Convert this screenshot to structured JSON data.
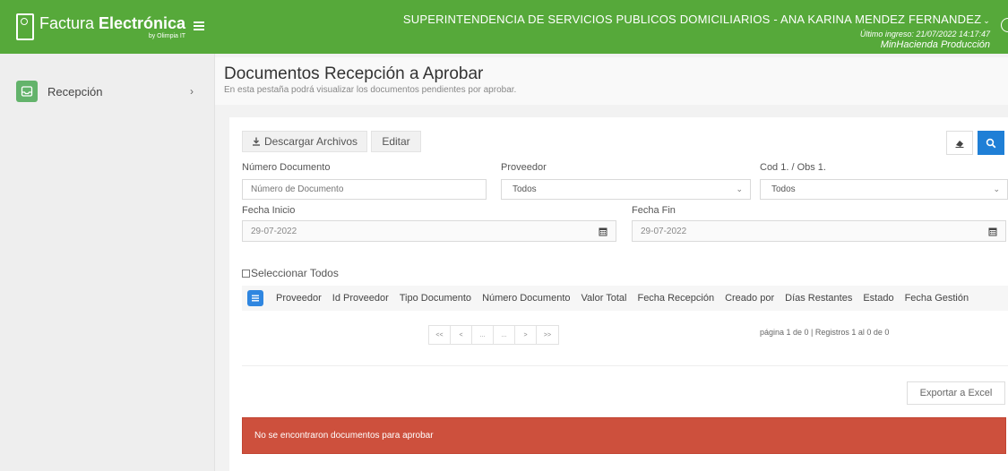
{
  "brand": {
    "name_light": "Factura ",
    "name_bold": "Electrónica",
    "by": "by Olimpia IT"
  },
  "user": {
    "name": "SUPERINTENDENCIA DE SERVICIOS PUBLICOS DOMICILIARIOS - ANA KARINA MENDEZ FERNANDEZ",
    "last_login": "Último ingreso: 21/07/2022 14:17:47",
    "environment": "MinHacienda Producción"
  },
  "sidebar": {
    "items": [
      {
        "label": "Recepción",
        "icon": "inbox-icon"
      }
    ]
  },
  "header": {
    "title": "Documentos Recepción a Aprobar",
    "subtitle": "En esta pestaña podrá visualizar los documentos pendientes por aprobar."
  },
  "toolbar": {
    "download_label": "Descargar Archivos",
    "edit_label": "Editar",
    "export_label": "Exportar a Excel"
  },
  "filters": {
    "numero_documento": {
      "label": "Número Documento",
      "placeholder": "Número de Documento"
    },
    "proveedor": {
      "label": "Proveedor",
      "value": "Todos"
    },
    "cod_obs": {
      "label": "Cod 1. / Obs 1.",
      "value": "Todos"
    },
    "fecha_inicio": {
      "label": "Fecha Inicio",
      "value": "29-07-2022"
    },
    "fecha_fin": {
      "label": "Fecha Fin",
      "value": "29-07-2022"
    }
  },
  "table": {
    "select_all_label": "Seleccionar Todos",
    "columns": [
      "Proveedor",
      "Id Proveedor",
      "Tipo Documento",
      "Número Documento",
      "Valor Total",
      "Fecha Recepción",
      "Creado por",
      "Días Restantes",
      "Estado",
      "Fecha Gestión"
    ],
    "pager": [
      "<<",
      "<",
      "...",
      "...",
      ">",
      ">>"
    ],
    "page_info": "página 1 de 0 | Registros 1 al 0 de 0"
  },
  "alert": {
    "message": "No se encontraron documentos para aprobar",
    "color": "#cd503d"
  },
  "colors": {
    "topbar": "#56a93a",
    "primary": "#1f7fd6",
    "sidebar_icon": "#63b36b"
  }
}
